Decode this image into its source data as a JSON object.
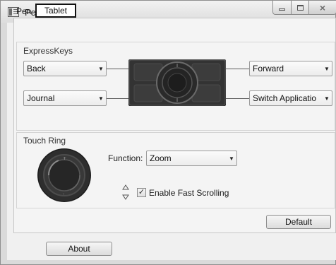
{
  "window": {
    "title": "Pen Tablet",
    "controls": {
      "minimize": "minimize",
      "maximize": "maximize",
      "close": "×"
    }
  },
  "tabs": [
    {
      "label": "Pen",
      "selected": false
    },
    {
      "label": "Tablet",
      "selected": true
    }
  ],
  "express_keys": {
    "group_label": "ExpressKeys",
    "top_left": "Back",
    "bottom_left": "Journal",
    "top_right": "Forward",
    "bottom_right": "Switch Applicatio"
  },
  "touch_ring": {
    "group_label": "Touch Ring",
    "function_label": "Function:",
    "function_value": "Zoom",
    "fast_scrolling_label": "Enable Fast Scrolling",
    "fast_scrolling_checked": true
  },
  "buttons": {
    "default": "Default",
    "about": "About"
  },
  "colors": {
    "window_bg": "#f0f0f0",
    "pad": "#2b2b2b",
    "border": "#9a9a9a"
  },
  "icons": {
    "app": "pen-tablet-app-icon",
    "dropdown": "chevron-down-icon",
    "scroll": "scroll-updown-icon",
    "checkmark": "checkmark-icon"
  }
}
